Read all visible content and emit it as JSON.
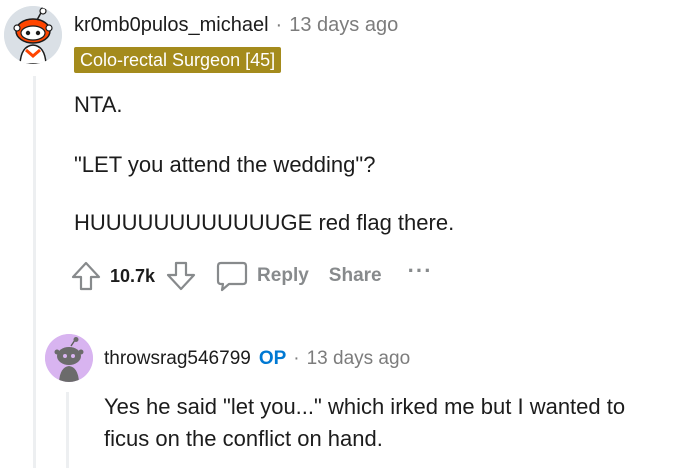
{
  "comment": {
    "username": "kr0mb0pulos_michael",
    "separator": "·",
    "time": "13 days ago",
    "flair": "Colo-rectal Surgeon [45]",
    "paragraphs": [
      "NTA.",
      "\"LET you attend the wedding\"?",
      "HUUUUUUUUUUUUGE red flag there."
    ],
    "actions": {
      "upvote_icon": "arrow-up-icon",
      "vote_count": "10.7k",
      "downvote_icon": "arrow-down-icon",
      "reply_icon": "speech-bubble-icon",
      "reply_label": "Reply",
      "share_label": "Share",
      "more_label": "···"
    }
  },
  "reply": {
    "username": "throwsrag546799",
    "op_badge": "OP",
    "separator": "·",
    "time": "13 days ago",
    "lines": [
      "Yes he said \"let you...\" which irked me but I wanted to",
      "ficus on the conflict on hand."
    ]
  },
  "colors": {
    "flair_bg": "#a48b1c",
    "op_blue": "#0079d3",
    "muted": "#878a8c"
  }
}
